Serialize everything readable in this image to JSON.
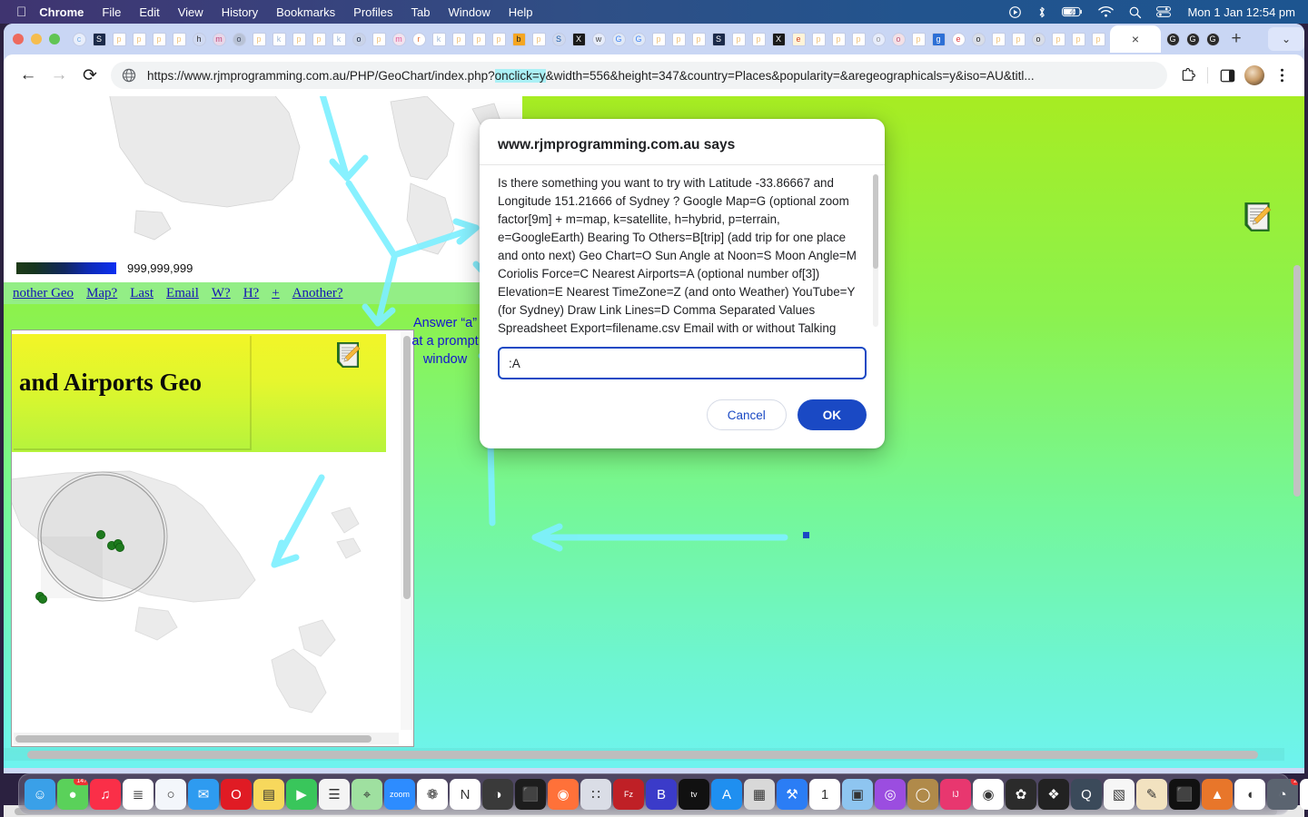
{
  "menubar": {
    "apple_icon": "apple-logo",
    "items": [
      {
        "label": "Chrome",
        "bold": true
      },
      {
        "label": "File",
        "bold": false
      },
      {
        "label": "Edit",
        "bold": false
      },
      {
        "label": "View",
        "bold": false
      },
      {
        "label": "History",
        "bold": false
      },
      {
        "label": "Bookmarks",
        "bold": false
      },
      {
        "label": "Profiles",
        "bold": false
      },
      {
        "label": "Tab",
        "bold": false
      },
      {
        "label": "Window",
        "bold": false
      },
      {
        "label": "Help",
        "bold": false
      }
    ],
    "status_icons": [
      "screen-record-icon",
      "bluetooth-icon",
      "battery-charging-icon",
      "wifi-icon",
      "search-icon",
      "control-center-icon"
    ],
    "clock": "Mon 1 Jan  12:54 pm"
  },
  "browser": {
    "window_controls": [
      "close-button",
      "minimize-button",
      "maximize-button"
    ],
    "back_label": "←",
    "forward_label": "→",
    "reload_label": "⟳",
    "url": "https://www.rjmprogramming.com.au/PHP/GeoChart/index.php?",
    "url_highlight": "onclick=y",
    "url_rest": "&width=556&height=347&country=Places&popularity=&aregeographicals=y&iso=AU&titl...",
    "tab_close_label": "×",
    "newtab_label": "+",
    "tablist_label": "⌄",
    "toolbar_icons": [
      "extensions-icon",
      "side-panel-icon",
      "profile-avatar",
      "chrome-menu-icon"
    ]
  },
  "page": {
    "legend_value": "999,999,999",
    "links": [
      "nother Geo",
      "Map?",
      "Last",
      "Email",
      "W?",
      "H?",
      "+",
      "Another?"
    ],
    "banner_title": "and Airports Geo",
    "annotation": "Answer “a”\nat a prompt\nwindow",
    "note_icon": "note-pencil-icon",
    "accent_bg_top": "#a7ec22",
    "accent_bg_bottom": "#6ef3ef",
    "marker_color": "#1e7a1e",
    "arrow_color": "#7df3ff"
  },
  "dialog": {
    "title": "www.rjmprogramming.com.au says",
    "message": "Is there something you want to try with Latitude -33.86667 and Longitude 151.21666 of Sydney ?   Google Map=G (optional zoom factor[9m] + m=map, k=satellite, h=hybrid, p=terrain, e=GoogleEarth) Bearing To Others=B[trip] (add trip for one place and onto next) Geo Chart=O Sun Angle at Noon=S Moon Angle=M Coriolis Force=C Nearest Airports=A (optional number of[3]) Elevation=E Nearest TimeZone=Z (and onto Weather) YouTube=Y (for Sydney) Draw Link Lines=D  Comma Separated Values Spreadsheet Export=filename.csv  Email with or without Talking Point=fillin.email@address This is when the",
    "input_value": ":A",
    "input_placeholder": "",
    "cancel_label": "Cancel",
    "ok_label": "OK",
    "ok_color": "#1a49c4"
  },
  "dock": {
    "items": [
      {
        "name": "finder",
        "color": "#3aa0e8",
        "glyph": "☺",
        "running": true
      },
      {
        "name": "messages",
        "color": "#5ad15a",
        "glyph": "●",
        "badge": "147",
        "running": true
      },
      {
        "name": "music",
        "color": "#fa2f48",
        "glyph": "♫",
        "running": false
      },
      {
        "name": "reminders",
        "color": "#ffffff",
        "glyph": "≣",
        "running": false
      },
      {
        "name": "safari",
        "color": "#f3f6fb",
        "glyph": "○",
        "running": true
      },
      {
        "name": "mail",
        "color": "#2e9bf0",
        "glyph": "✉",
        "running": false
      },
      {
        "name": "opera",
        "color": "#e01b24",
        "glyph": "O",
        "running": false
      },
      {
        "name": "notes",
        "color": "#f7d85c",
        "glyph": "▤",
        "running": false
      },
      {
        "name": "facetime",
        "color": "#39c65b",
        "glyph": "▶",
        "running": false
      },
      {
        "name": "textedit",
        "color": "#f4f4f4",
        "glyph": "☰",
        "running": false
      },
      {
        "name": "maps",
        "color": "#9fe0a0",
        "glyph": "⌖",
        "running": false
      },
      {
        "name": "zoom",
        "color": "#2d8cff",
        "glyph": "zoom",
        "running": false
      },
      {
        "name": "photos",
        "color": "#ffffff",
        "glyph": "❁",
        "running": false
      },
      {
        "name": "news",
        "color": "#ffffff",
        "glyph": "N",
        "running": false
      },
      {
        "name": "gimp",
        "color": "#3a3a3a",
        "glyph": "◑",
        "running": false
      },
      {
        "name": "terminal",
        "color": "#1d1d1d",
        "glyph": "⬛",
        "running": false
      },
      {
        "name": "firefox",
        "color": "#ff7139",
        "glyph": "◉",
        "running": false
      },
      {
        "name": "launchpad",
        "color": "#dadde6",
        "glyph": "∷",
        "running": false
      },
      {
        "name": "filezilla",
        "color": "#bf2026",
        "glyph": "Fz",
        "running": true
      },
      {
        "name": "bitwarden",
        "color": "#3b3bc9",
        "glyph": "B",
        "running": true
      },
      {
        "name": "appletv",
        "color": "#111111",
        "glyph": "tv",
        "running": false
      },
      {
        "name": "appstore",
        "color": "#1f8ff0",
        "glyph": "A",
        "running": false
      },
      {
        "name": "calculator",
        "color": "#d8d8d8",
        "glyph": "▦",
        "running": false
      },
      {
        "name": "xcode",
        "color": "#2b7df5",
        "glyph": "⚒",
        "running": false
      },
      {
        "name": "calendar",
        "color": "#ffffff",
        "glyph": "1",
        "running": false
      },
      {
        "name": "preview",
        "color": "#8ec5f0",
        "glyph": "▣",
        "running": false
      },
      {
        "name": "podcasts",
        "color": "#9b4de0",
        "glyph": "◎",
        "running": false
      },
      {
        "name": "keychain",
        "color": "#b08a4a",
        "glyph": "◯",
        "running": false
      },
      {
        "name": "intellij",
        "color": "#e8376f",
        "glyph": "IJ",
        "running": false
      },
      {
        "name": "chrome",
        "color": "#ffffff",
        "glyph": "◉",
        "running": true
      },
      {
        "name": "inkscape",
        "color": "#2b2b2b",
        "glyph": "✿",
        "running": false
      },
      {
        "name": "shortcuts",
        "color": "#222222",
        "glyph": "❖",
        "running": true
      },
      {
        "name": "quicktime",
        "color": "#3b4a5a",
        "glyph": "Q",
        "running": false
      },
      {
        "name": "pages",
        "color": "#f6f6f6",
        "glyph": "▧",
        "running": false
      },
      {
        "name": "paintbrush",
        "color": "#f2e2c0",
        "glyph": "✎",
        "running": true
      },
      {
        "name": "iterm",
        "color": "#111111",
        "glyph": "⬛",
        "running": false
      },
      {
        "name": "vlc",
        "color": "#e8762a",
        "glyph": "▲",
        "running": true
      },
      {
        "name": "evernote",
        "color": "#ffffff",
        "glyph": "◖",
        "running": false
      },
      {
        "name": "activity-monitor",
        "color": "#5b6470",
        "glyph": "◔",
        "badge": "2",
        "running": true
      },
      {
        "name": "textedit2",
        "color": "#ffffff",
        "glyph": "✐",
        "running": false
      },
      {
        "name": "opera2",
        "color": "#e01b24",
        "glyph": "O",
        "running": false
      },
      {
        "name": "downloads-stack",
        "color": "#d9e6c8",
        "glyph": "▤",
        "running": false
      },
      {
        "name": "globe-browser",
        "color": "#2a7fd0",
        "glyph": "⊕",
        "running": false
      },
      {
        "name": "window-thumb-1",
        "color": "#f2f2f2",
        "glyph": "≡",
        "running": false
      },
      {
        "name": "window-thumb-2",
        "color": "#f2f2f2",
        "glyph": "≡",
        "running": false
      },
      {
        "name": "window-thumb-3",
        "color": "#f2f2f2",
        "glyph": "≡",
        "running": false
      },
      {
        "name": "window-thumb-4",
        "color": "#ececec",
        "glyph": "▭",
        "running": false
      },
      {
        "name": "window-thumb-5",
        "color": "#f2f2f2",
        "glyph": "▭",
        "running": false
      },
      {
        "name": "trash",
        "color": "#cfd6df",
        "glyph": "♻",
        "running": false
      }
    ]
  }
}
